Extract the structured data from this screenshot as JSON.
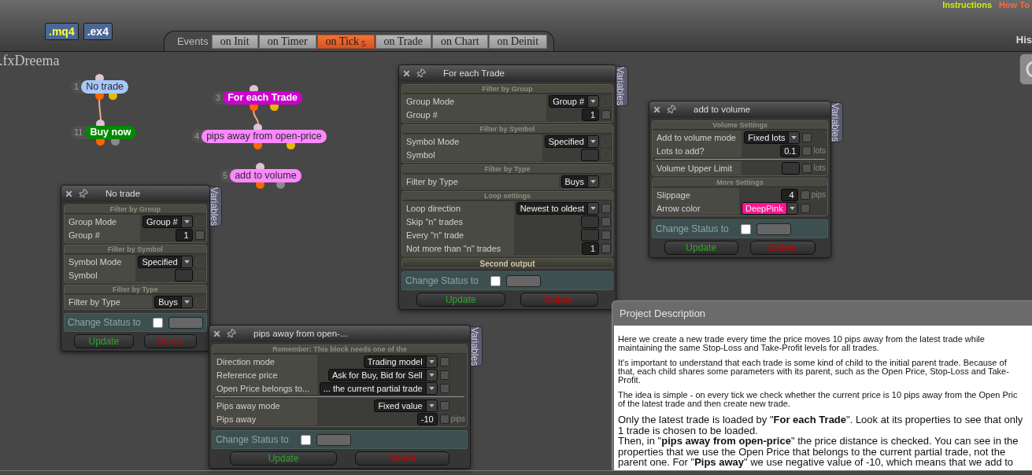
{
  "export_buttons": [
    {
      "label": ".mq4",
      "kind": "mq4"
    },
    {
      "label": ".ex4",
      "kind": "ex4"
    }
  ],
  "events": {
    "label": "Events",
    "tabs": [
      {
        "label": "on Init",
        "selected": false
      },
      {
        "label": "on Timer",
        "selected": false
      },
      {
        "label": "on Tick",
        "count": "5",
        "selected": true
      },
      {
        "label": "on Trade",
        "selected": false
      },
      {
        "label": "on Chart",
        "selected": false
      },
      {
        "label": "on Deinit",
        "selected": false
      }
    ]
  },
  "top_links": [
    {
      "label": "Instructions",
      "color": "#c8f000"
    },
    {
      "label": "How To",
      "color": "#ff6a3c"
    }
  ],
  "side_heading": "His",
  "logo": ".fxDreema",
  "nodes": [
    {
      "number": "1",
      "label": "No trade",
      "color": "#a8c8f8",
      "outputs": [
        {
          "color": "#ff6600"
        },
        {
          "color": "#e8b800"
        }
      ]
    },
    {
      "number": "11",
      "label": "Buy now",
      "color": "#008a00",
      "outputs": [
        {
          "color": "#ff6600"
        },
        {
          "color": "#8a8a8a"
        }
      ]
    },
    {
      "number": "3",
      "label": "For each Trade",
      "color": "#cc00cc",
      "outputs": [
        {
          "color": "#ff6600"
        },
        {
          "color": "#e8b800"
        }
      ]
    },
    {
      "number": "4",
      "label": "pips away from open-price",
      "color": "#ff88ff",
      "outputs": [
        {
          "color": "#ff6600"
        },
        {
          "color": "#e8b800"
        }
      ]
    },
    {
      "number": "5",
      "label": "add to volume",
      "color": "#ff88ff",
      "outputs": [
        {
          "color": "#ff6600"
        },
        {
          "color": "#8a8a8a"
        }
      ]
    }
  ],
  "windows": [
    {
      "title": "No trade",
      "side_tab": "Variables",
      "sections": [
        {
          "title": "Filter by Group",
          "kind": "filter",
          "rows": [
            {
              "label": "Group Mode",
              "kind": "select",
              "value": "Group #",
              "checked": false,
              "disabled": true
            },
            {
              "label": "Group #",
              "kind": "number",
              "value": "1",
              "checked": false,
              "disabled": false
            }
          ]
        },
        {
          "title": "Filter by Symbol",
          "kind": "filter",
          "rows": [
            {
              "label": "Symbol Mode",
              "kind": "select",
              "value": "Specified",
              "checked": false,
              "disabled": true
            },
            {
              "label": "Symbol",
              "kind": "input",
              "checked": false,
              "disabled": true
            }
          ]
        },
        {
          "title": "Filter by Type",
          "kind": "filter",
          "rows": [
            {
              "label": "Filter by Type",
              "kind": "select",
              "value": "Buys",
              "checked": false,
              "disabled": true
            }
          ]
        }
      ],
      "change_status": {
        "label": "Change Status to",
        "checked": false
      },
      "buttons": [
        {
          "label": "Update",
          "kind": "update"
        },
        {
          "label": "Delete",
          "kind": "delete"
        }
      ]
    },
    {
      "title": "For each Trade",
      "side_tab": "Variables",
      "sections": [
        {
          "title": "Filter by Group",
          "kind": "filter",
          "rows": [
            {
              "label": "Group Mode",
              "kind": "select",
              "value": "Group #",
              "checked": false,
              "disabled": true
            },
            {
              "label": "Group #",
              "kind": "number",
              "value": "1",
              "checked": false,
              "disabled": false
            }
          ]
        },
        {
          "title": "Filter by Symbol",
          "kind": "filter",
          "rows": [
            {
              "label": "Symbol Mode",
              "kind": "select",
              "value": "Specified",
              "checked": false,
              "disabled": true
            },
            {
              "label": "Symbol",
              "kind": "input",
              "checked": false,
              "disabled": true
            }
          ]
        },
        {
          "title": "Filter by Type",
          "kind": "filter",
          "rows": [
            {
              "label": "Filter by Type",
              "kind": "select",
              "value": "Buys",
              "checked": false,
              "disabled": true
            }
          ]
        },
        {
          "title": "Loop settings",
          "kind": "filter",
          "rows": [
            {
              "label": "Loop direction",
              "kind": "select",
              "value": "Newest to oldest",
              "checked": false,
              "disabled": false
            },
            {
              "label": "Skip \"n\" trades",
              "kind": "input",
              "checked": false,
              "disabled": false
            },
            {
              "label": "Every \"n\" trade",
              "kind": "input",
              "checked": false,
              "disabled": false
            },
            {
              "label": "Not more than \"n\" trades",
              "kind": "number",
              "value": "1",
              "checked": false,
              "disabled": false
            }
          ]
        },
        {
          "title": "Second output",
          "kind": "output"
        }
      ],
      "change_status": {
        "label": "Change Status to",
        "checked": false
      },
      "buttons": [
        {
          "label": "Update",
          "kind": "update"
        },
        {
          "label": "Delete",
          "kind": "delete"
        }
      ]
    },
    {
      "title": "add to volume",
      "side_tab": "Variables",
      "sections": [
        {
          "title": "Volume Settings",
          "kind": "filter",
          "rows": [
            {
              "label": "Add to volume mode",
              "kind": "select",
              "value": "Fixed lots",
              "checked": false,
              "disabled": false
            },
            {
              "label": "Lots to add?",
              "kind": "number",
              "value": "0.1",
              "unit": "lots",
              "checked": false,
              "disabled": false
            },
            {
              "label": "Volume Upper Limit",
              "kind": "input",
              "unit": "lots",
              "rule_above": true,
              "checked": false,
              "disabled": false
            }
          ]
        },
        {
          "title": "More Settings",
          "kind": "filter",
          "rows": [
            {
              "label": "Slippage",
              "kind": "number",
              "value": "4",
              "unit": "pips",
              "checked": false,
              "disabled": false
            },
            {
              "label": "Arrow color",
              "kind": "select",
              "value": "DeepPink",
              "color": "#ff1493",
              "checked": false,
              "disabled": false
            }
          ]
        }
      ],
      "change_status": {
        "label": "Change Status to",
        "checked": false
      },
      "buttons": [
        {
          "label": "Update",
          "kind": "update"
        },
        {
          "label": "Delete",
          "kind": "delete"
        }
      ]
    },
    {
      "title": "pips away from open-...",
      "side_tab": "Variables",
      "sections": [
        {
          "title": "Remember: This block needs one of the",
          "kind": "filter",
          "rows": [
            {
              "label": "Direction mode",
              "kind": "select",
              "value": "Trading model",
              "checked": false,
              "disabled": false
            },
            {
              "label": "Reference price",
              "kind": "select",
              "value": "Ask for Buy, Bid for Sell",
              "checked": false,
              "disabled": false
            },
            {
              "label": "Open Price belongs to...",
              "kind": "select",
              "value": "... the current partial trade",
              "checked": false,
              "disabled": false
            },
            {
              "label": "Pips away mode",
              "kind": "select",
              "value": "Fixed value",
              "rule_above": true,
              "checked": false,
              "disabled": false
            },
            {
              "label": "Pips away",
              "kind": "number",
              "value": "-10",
              "unit": "pips",
              "checked": false,
              "disabled": false
            }
          ]
        }
      ],
      "change_status": {
        "label": "Change Status to",
        "checked": false
      },
      "buttons": [
        {
          "label": "Update",
          "kind": "update"
        },
        {
          "label": "Delete",
          "kind": "delete"
        }
      ]
    }
  ],
  "project_description": {
    "title": "Project Description",
    "paragraphs": [
      {
        "kind": "small",
        "lines": [
          "Here we create a new trade every time the price moves 10 pips away from the latest trade while",
          "maintaining the same Stop-Loss and Take-Profit levels for all trades."
        ]
      },
      {
        "kind": "small",
        "lines": [
          "It's important to understand that each trade is some kind of child to the initial parent trade. Because of",
          "that, each child shares some parameters with its parent, such as the Open Price, Stop-Loss and Take-",
          "Profit."
        ]
      },
      {
        "kind": "small",
        "lines": [
          "The idea is simple - on every tick we check whether the current price is 10 pips away from the Open Pric",
          "of the latest trade and then create new trade."
        ]
      },
      {
        "kind": "large",
        "lines": [
          "Only the latest trade is loaded by \"**For each Trade**\". Look at its properties to see that only",
          "1 trade is chosen to be loaded.",
          "Then, in \"**pips away from open-price**\" the price distance is checked. You can see in the",
          "properties that we use the Open Price that belongs to the current partial trade, not the",
          "parent one. For \"**Pips away**\" we use negative value of -10, which means that we add to"
        ]
      }
    ]
  }
}
